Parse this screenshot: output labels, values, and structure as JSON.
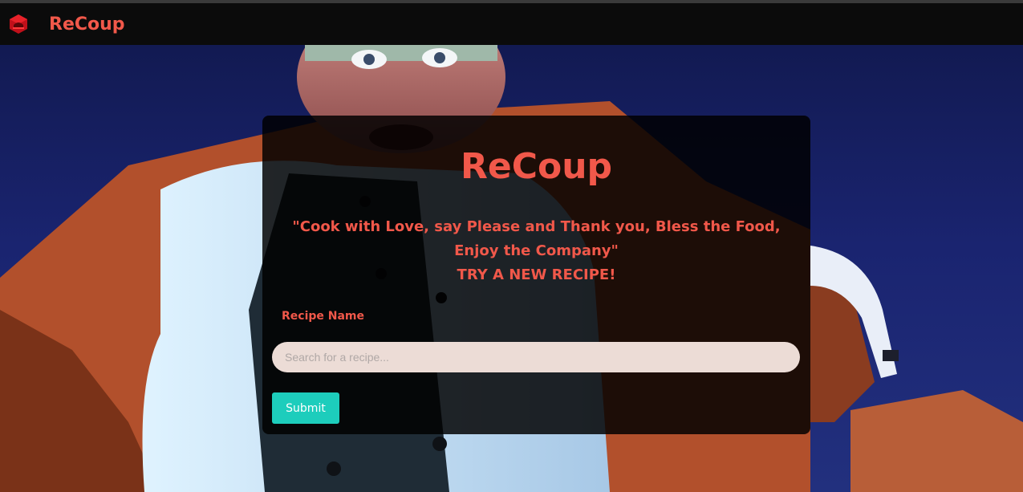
{
  "navbar": {
    "brand": "ReCoup",
    "icon": "recoup-logo-icon"
  },
  "hero": {
    "background": "animated-chef-scene"
  },
  "card": {
    "title": "ReCoup",
    "quote": "\"Cook with Love, say Please and Thank you, Bless the Food, Enjoy the Company\"",
    "tagline": "TRY A NEW RECIPE!",
    "recipe_label": "Recipe Name",
    "search_placeholder": "Search for a recipe...",
    "search_value": "",
    "submit_label": "Submit"
  },
  "colors": {
    "accent": "#f1584a",
    "button": "#1dcdbc",
    "navbar": "#0b0b0b"
  }
}
